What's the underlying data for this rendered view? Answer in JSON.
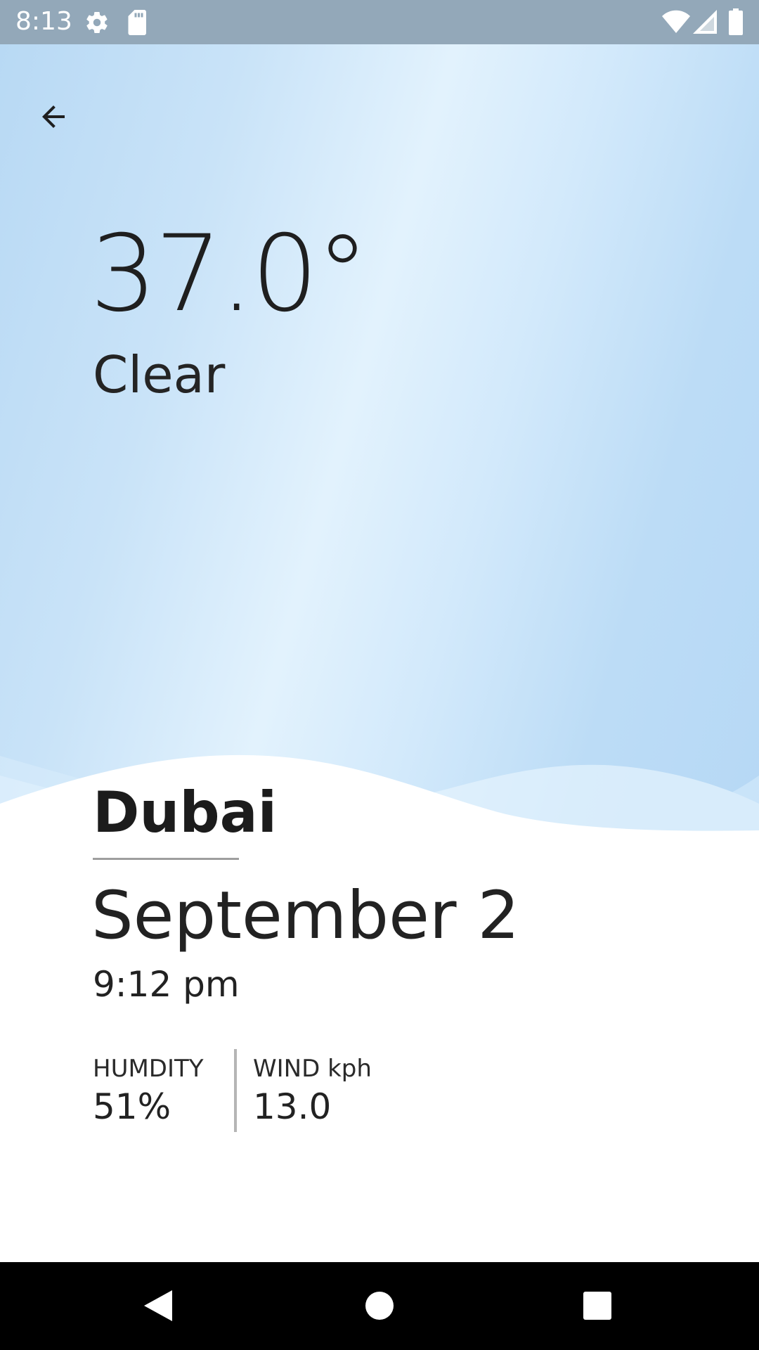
{
  "status_bar": {
    "time": "8:13",
    "icons": [
      "settings-icon",
      "sd-card-icon",
      "wifi-icon",
      "signal-icon",
      "battery-icon"
    ]
  },
  "header": {
    "back_icon": "arrow-back-icon"
  },
  "weather": {
    "temperature": "37.0°",
    "condition": "Clear"
  },
  "location": {
    "city": "Dubai",
    "date": "September 2",
    "time": "9:12 pm"
  },
  "stats": {
    "humidity_label": "HUMDITY",
    "humidity_value": "51%",
    "wind_label": "WIND kph",
    "wind_value": "13.0"
  },
  "nav_bar": {
    "icons": [
      "back-triangle-icon",
      "home-circle-icon",
      "recents-square-icon"
    ]
  },
  "colors": {
    "sky_light": "#e2f2fd",
    "sky_blue": "#b8d9f4",
    "status_bar": "#93a8b9",
    "text": "#212121"
  }
}
